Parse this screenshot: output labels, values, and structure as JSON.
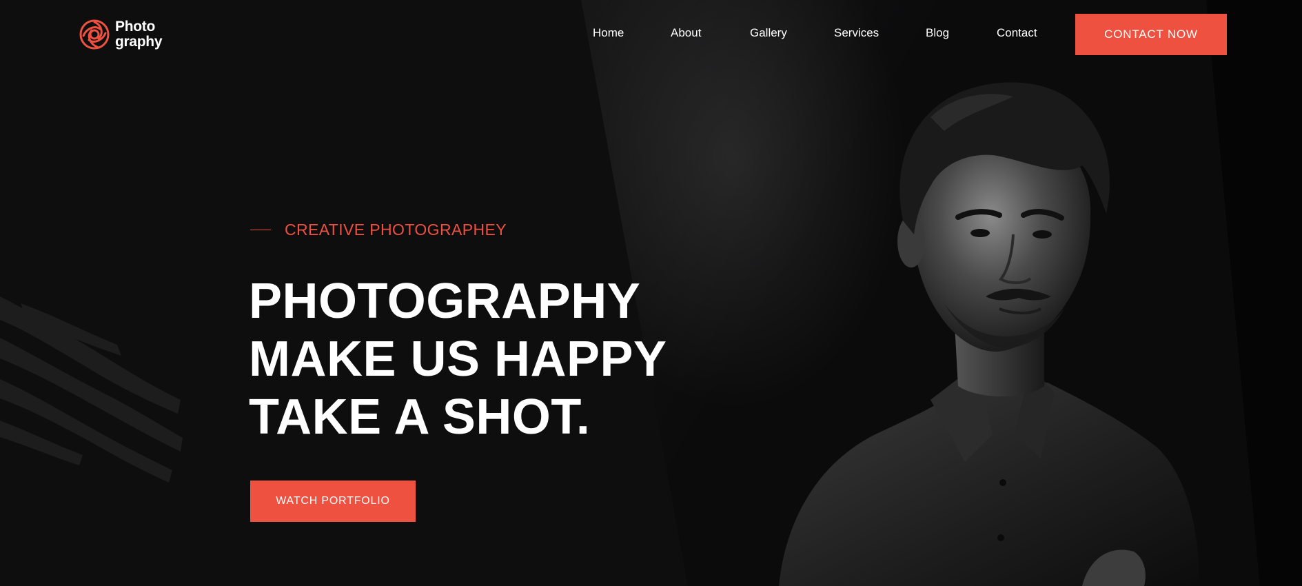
{
  "brand": {
    "line1": "Photo",
    "line2": "graphy",
    "accent_color": "#ef5140",
    "icon": "camera-aperture-icon"
  },
  "nav": {
    "items": [
      {
        "label": "Home"
      },
      {
        "label": "About"
      },
      {
        "label": "Gallery"
      },
      {
        "label": "Services"
      },
      {
        "label": "Blog"
      },
      {
        "label": "Contact"
      }
    ],
    "cta_label": "CONTACT NOW"
  },
  "hero": {
    "kicker": "CREATIVE PHOTOGRAPHEY",
    "headline": [
      "PHOTOGRAPHY",
      "MAKE US HAPPY",
      "TAKE A SHOT."
    ],
    "button_label": "WATCH PORTFOLIO",
    "image": "portrait-photo"
  },
  "colors": {
    "background": "#0e0e0f",
    "accent": "#ef5140",
    "text": "#ffffff"
  }
}
